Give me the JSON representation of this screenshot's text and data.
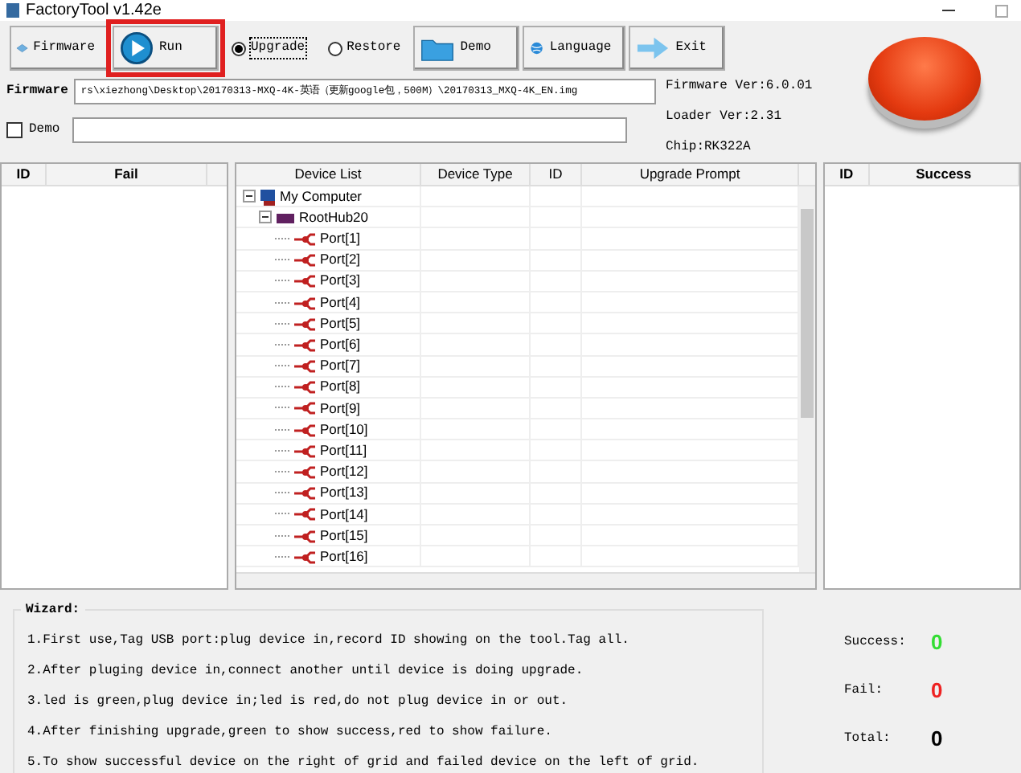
{
  "window": {
    "title": "FactoryTool v1.42e"
  },
  "toolbar": {
    "buttons": [
      {
        "kind": "firmware",
        "label": "Firmware",
        "highlighted": false
      },
      {
        "kind": "run",
        "label": "Run",
        "highlighted": true
      }
    ],
    "modes": [
      {
        "label": "Upgrade",
        "selected": true
      },
      {
        "label": "Restore",
        "selected": false
      }
    ],
    "buttons_right": [
      {
        "kind": "demo",
        "label": "Demo"
      },
      {
        "kind": "language",
        "label": "Language"
      },
      {
        "kind": "exit",
        "label": "Exit"
      }
    ]
  },
  "firmware": {
    "label": "Firmware",
    "value": "rs\\xiezhong\\Desktop\\20170313-MXQ-4K-英语（更新google包，500M）\\20170313_MXQ-4K_EN.img"
  },
  "demo": {
    "label": "Demo",
    "checked": false
  },
  "info": [
    "Firmware Ver:6.0.01",
    "Loader Ver:2.31",
    "Chip:RK322A"
  ],
  "fail_grid": {
    "columns": [
      "ID",
      "Fail"
    ]
  },
  "device_grid": {
    "columns": [
      "Device List",
      "Device Type",
      "ID",
      "Upgrade Prompt"
    ],
    "tree": [
      {
        "kind": "computer",
        "label": "My Computer",
        "expanded": true,
        "children": [
          {
            "kind": "hub",
            "label": "RootHub20",
            "expanded": true,
            "children": [
              {
                "kind": "port",
                "label": "Port[1]"
              },
              {
                "kind": "port",
                "label": "Port[2]"
              },
              {
                "kind": "port",
                "label": "Port[3]"
              },
              {
                "kind": "port",
                "label": "Port[4]"
              },
              {
                "kind": "port",
                "label": "Port[5]"
              },
              {
                "kind": "port",
                "label": "Port[6]"
              },
              {
                "kind": "port",
                "label": "Port[7]"
              },
              {
                "kind": "port",
                "label": "Port[8]"
              },
              {
                "kind": "port",
                "label": "Port[9]"
              },
              {
                "kind": "port",
                "label": "Port[10]"
              },
              {
                "kind": "port",
                "label": "Port[11]"
              },
              {
                "kind": "port",
                "label": "Port[12]"
              },
              {
                "kind": "port",
                "label": "Port[13]"
              },
              {
                "kind": "port",
                "label": "Port[14]"
              },
              {
                "kind": "port",
                "label": "Port[15]"
              },
              {
                "kind": "port",
                "label": "Port[16]"
              }
            ]
          }
        ]
      }
    ]
  },
  "success_grid": {
    "columns": [
      "ID",
      "Success"
    ]
  },
  "wizard": {
    "title": "Wizard:",
    "lines": [
      "1.First use,Tag USB port:plug device in,record ID showing on the tool.Tag all.",
      "2.After pluging device in,connect another until device is doing upgrade.",
      "3.led is green,plug device in;led is red,do not plug device in or out.",
      "4.After finishing upgrade,green to show success,red to show failure.",
      "5.To show successful device on the right of grid and failed device on the left of grid."
    ]
  },
  "stats": [
    {
      "kind": "success",
      "label": "Success:",
      "value": "0"
    },
    {
      "kind": "fail",
      "label": "Fail:",
      "value": "0"
    },
    {
      "kind": "total",
      "label": "Total:",
      "value": "0"
    }
  ]
}
